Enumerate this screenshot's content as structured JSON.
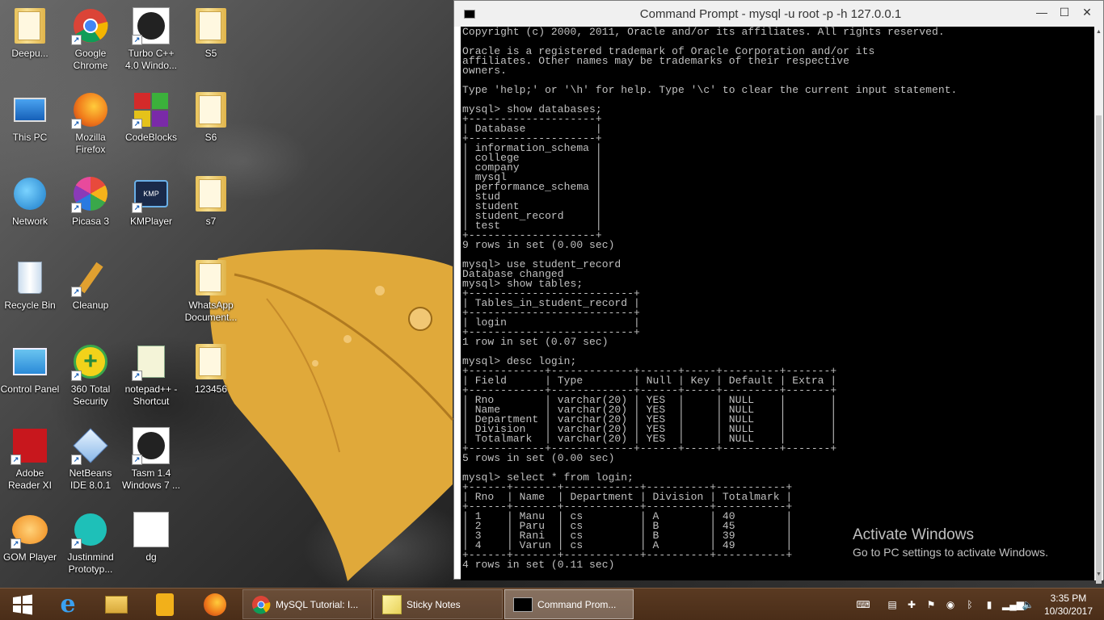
{
  "desktop": {
    "icons": [
      {
        "label": "Deepu..."
      },
      {
        "label": "Google Chrome"
      },
      {
        "label": "Turbo C++ 4.0 Windo..."
      },
      {
        "label": "S5"
      },
      {
        "label": "This PC"
      },
      {
        "label": "Mozilla Firefox"
      },
      {
        "label": "CodeBlocks"
      },
      {
        "label": "S6"
      },
      {
        "label": "Network"
      },
      {
        "label": "Picasa 3"
      },
      {
        "label": "KMPlayer"
      },
      {
        "label": "s7"
      },
      {
        "label": "Recycle Bin"
      },
      {
        "label": "Cleanup"
      },
      {
        "label": "WhatsApp Document..."
      },
      {
        "label": "Control Panel"
      },
      {
        "label": "360 Total Security"
      },
      {
        "label": "notepad++ - Shortcut"
      },
      {
        "label": "123456"
      },
      {
        "label": "Adobe Reader XI"
      },
      {
        "label": "NetBeans IDE 8.0.1"
      },
      {
        "label": "Tasm 1.4 Windows 7 ..."
      },
      {
        "label": "GOM Player"
      },
      {
        "label": "Justinmind Prototyp..."
      },
      {
        "label": "dg"
      }
    ],
    "watermark": {
      "title": "Activate Windows",
      "subtitle": "Go to PC settings to activate Windows."
    }
  },
  "console": {
    "title": "Command Prompt - mysql  -u root -p -h 127.0.0.1",
    "buttons": {
      "minimize": "—",
      "maximize": "☐",
      "close": "✕"
    },
    "lines": [
      "Copyright (c) 2000, 2011, Oracle and/or its affiliates. All rights reserved.",
      "",
      "Oracle is a registered trademark of Oracle Corporation and/or its",
      "affiliates. Other names may be trademarks of their respective",
      "owners.",
      "",
      "Type 'help;' or '\\h' for help. Type '\\c' to clear the current input statement.",
      "",
      "mysql> show databases;",
      "+--------------------+",
      "| Database           |",
      "+--------------------+",
      "| information_schema |",
      "| college            |",
      "| company            |",
      "| mysql              |",
      "| performance_schema |",
      "| stud               |",
      "| student            |",
      "| student_record     |",
      "| test               |",
      "+--------------------+",
      "9 rows in set (0.00 sec)",
      "",
      "mysql> use student_record",
      "Database changed",
      "mysql> show tables;",
      "+--------------------------+",
      "| Tables_in_student_record |",
      "+--------------------------+",
      "| login                    |",
      "+--------------------------+",
      "1 row in set (0.07 sec)",
      "",
      "mysql> desc login;",
      "+------------+-------------+------+-----+---------+-------+",
      "| Field      | Type        | Null | Key | Default | Extra |",
      "+------------+-------------+------+-----+---------+-------+",
      "| Rno        | varchar(20) | YES  |     | NULL    |       |",
      "| Name       | varchar(20) | YES  |     | NULL    |       |",
      "| Department | varchar(20) | YES  |     | NULL    |       |",
      "| Division   | varchar(20) | YES  |     | NULL    |       |",
      "| Totalmark  | varchar(20) | YES  |     | NULL    |       |",
      "+------------+-------------+------+-----+---------+-------+",
      "5 rows in set (0.00 sec)",
      "",
      "mysql> select * from login;",
      "+------+-------+------------+----------+-----------+",
      "| Rno  | Name  | Department | Division | Totalmark |",
      "+------+-------+------------+----------+-----------+",
      "| 1    | Manu  | cs         | A        | 40        |",
      "| 2    | Paru  | cs         | B        | 45        |",
      "| 3    | Rani  | cs         | B        | 39        |",
      "| 4    | Varun | cs         | A        | 49        |",
      "+------+-------+------------+----------+-----------+",
      "4 rows in set (0.11 sec)"
    ]
  },
  "taskbar": {
    "tasks": [
      {
        "label": "MySQL Tutorial: I..."
      },
      {
        "label": "Sticky Notes"
      },
      {
        "label": "Command Prom..."
      }
    ],
    "clock": {
      "time": "3:35 PM",
      "date": "10/30/2017"
    }
  }
}
